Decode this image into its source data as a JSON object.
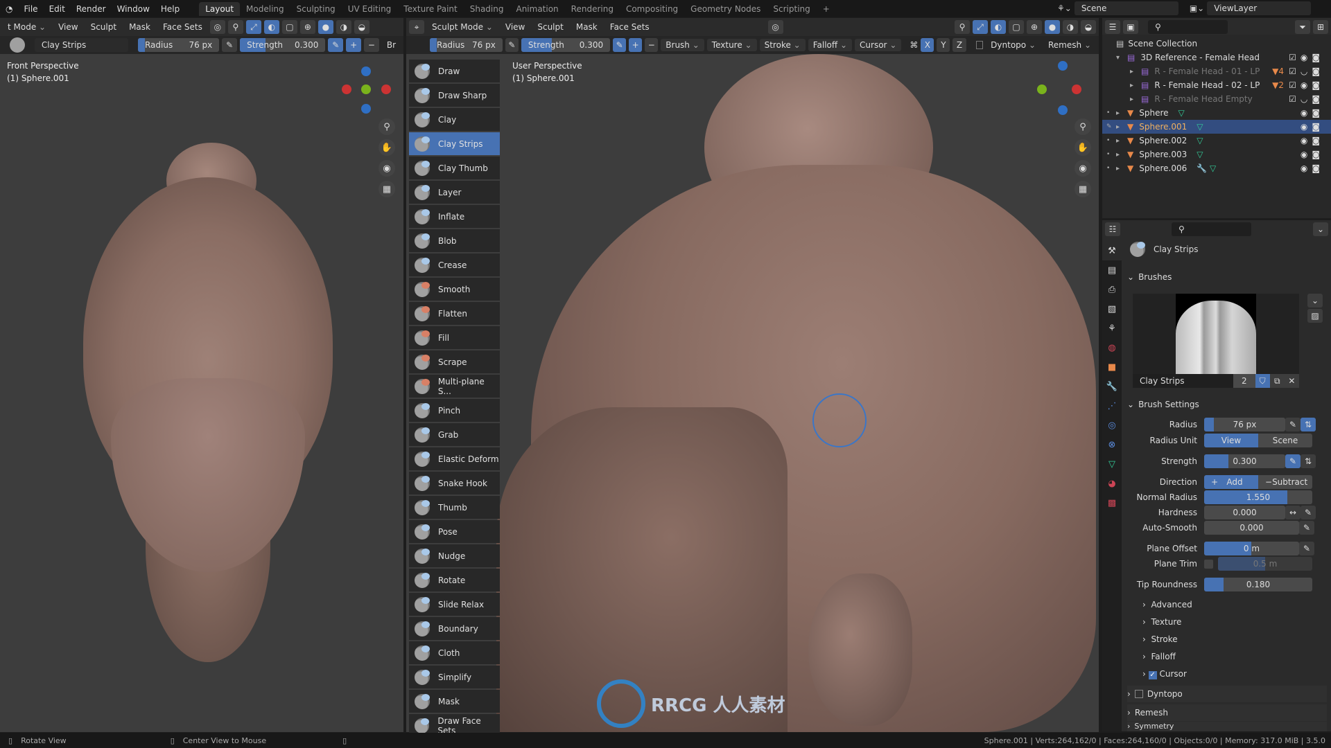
{
  "topbar": {
    "menus": [
      "File",
      "Edit",
      "Render",
      "Window",
      "Help"
    ],
    "workspaces": [
      "Layout",
      "Modeling",
      "Sculpting",
      "UV Editing",
      "Texture Paint",
      "Shading",
      "Animation",
      "Rendering",
      "Compositing",
      "Geometry Nodes",
      "Scripting",
      "+"
    ],
    "active_workspace": "Layout",
    "scene": "Scene",
    "view_layer": "ViewLayer"
  },
  "left_header": {
    "mode": "t Mode",
    "menus": [
      "View",
      "Sculpt",
      "Mask",
      "Face Sets"
    ],
    "brush_name": "Clay Strips",
    "radius_label": "Radius",
    "radius_value": "76 px",
    "strength_label": "Strength",
    "strength_value": "0.300",
    "truncated": "Br"
  },
  "right_header": {
    "mode": "Sculpt Mode",
    "menus": [
      "View",
      "Sculpt",
      "Mask",
      "Face Sets"
    ],
    "radius_label": "Radius",
    "radius_value": "76 px",
    "strength_label": "Strength",
    "strength_value": "0.300",
    "dropdowns": [
      "Brush",
      "Texture",
      "Stroke",
      "Falloff",
      "Cursor"
    ],
    "axes": [
      "X",
      "Y",
      "Z"
    ],
    "dyntopo": "Dyntopo",
    "remesh": "Remesh"
  },
  "left_viewport": {
    "title": "Front Perspective",
    "object": "(1) Sphere.001"
  },
  "right_viewport": {
    "title": "User Perspective",
    "object": "(1) Sphere.001"
  },
  "tools": [
    "Draw",
    "Draw Sharp",
    "Clay",
    "Clay Strips",
    "Clay Thumb",
    "Layer",
    "Inflate",
    "Blob",
    "Crease",
    "Smooth",
    "Flatten",
    "Fill",
    "Scrape",
    "Multi-plane S...",
    "Pinch",
    "Grab",
    "Elastic Deform",
    "Snake Hook",
    "Thumb",
    "Pose",
    "Nudge",
    "Rotate",
    "Slide Relax",
    "Boundary",
    "Cloth",
    "Simplify",
    "Mask",
    "Draw Face Sets"
  ],
  "active_tool": "Clay Strips",
  "outliner": {
    "root": "Scene Collection",
    "items": [
      {
        "name": "3D Reference - Female Head",
        "type": "collection",
        "level": 1,
        "expanded": true
      },
      {
        "name": "R - Female Head - 01 - LP",
        "type": "collection",
        "level": 2,
        "dim": true,
        "badge": "4"
      },
      {
        "name": "R - Female Head - 02 - LP",
        "type": "collection",
        "level": 2,
        "badge": "2"
      },
      {
        "name": "R - Female Head Empty",
        "type": "collection",
        "level": 2,
        "dim": true
      },
      {
        "name": "Sphere",
        "type": "mesh",
        "level": 1
      },
      {
        "name": "Sphere.001",
        "type": "mesh",
        "level": 1,
        "selected": true
      },
      {
        "name": "Sphere.002",
        "type": "mesh",
        "level": 1
      },
      {
        "name": "Sphere.003",
        "type": "mesh",
        "level": 1
      },
      {
        "name": "Sphere.006",
        "type": "mesh",
        "level": 1,
        "modifier": true
      }
    ]
  },
  "properties": {
    "brush_title": "Clay Strips",
    "brushes_panel": "Brushes",
    "brush_name": "Clay Strips",
    "brush_users": "2",
    "brush_settings_panel": "Brush Settings",
    "radius": {
      "label": "Radius",
      "value": "76 px"
    },
    "radius_unit": {
      "label": "Radius Unit",
      "options": [
        "View",
        "Scene"
      ],
      "selected": "View"
    },
    "strength": {
      "label": "Strength",
      "value": "0.300",
      "fraction": 0.3
    },
    "direction": {
      "label": "Direction",
      "options": [
        "Add",
        "Subtract"
      ],
      "selected": "Add"
    },
    "normal_radius": {
      "label": "Normal Radius",
      "value": "1.550"
    },
    "hardness": {
      "label": "Hardness",
      "value": "0.000"
    },
    "auto_smooth": {
      "label": "Auto-Smooth",
      "value": "0.000"
    },
    "plane_offset": {
      "label": "Plane Offset",
      "value": "0 m"
    },
    "plane_trim": {
      "label": "Plane Trim",
      "value": "0.5 m",
      "enabled": false
    },
    "tip_roundness": {
      "label": "Tip Roundness",
      "value": "0.180",
      "fraction": 0.18
    },
    "subpanels": [
      "Advanced",
      "Texture",
      "Stroke",
      "Falloff"
    ],
    "cursor": "Cursor",
    "dyntopo": "Dyntopo",
    "remesh": "Remesh",
    "symmetry": "Symmetry"
  },
  "status": {
    "left_action": "Rotate View",
    "middle_action": "Center View to Mouse",
    "stats": "Sphere.001 | Verts:264,162/0 | Faces:264,160/0 | Objects:0/0 | Memory: 317.0 MiB | 3.5.0"
  },
  "watermark": "RRCG 人人素材",
  "colors": {
    "accent": "#4772b3",
    "skin": "#8f7168",
    "background": "#3d3d3d"
  }
}
